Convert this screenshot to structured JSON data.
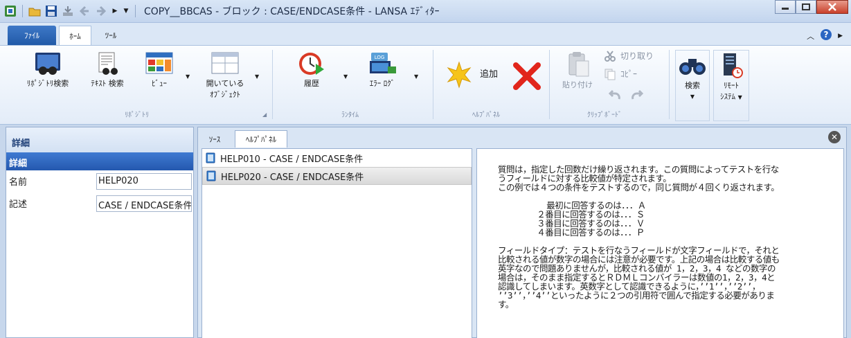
{
  "window": {
    "title": "COPY__BBCAS - ブロック : CASE/ENDCASE条件 - LANSA ｴﾃﾞｨﾀｰ"
  },
  "ribbon_tabs": {
    "file": "ﾌｧｲﾙ",
    "home": "ﾎｰﾑ",
    "tools": "ﾂｰﾙ"
  },
  "ribbon": {
    "repo_search": "ﾘﾎﾟｼﾞﾄﾘ検索",
    "text_search": "ﾃｷｽﾄ 検索",
    "view": "ﾋﾞｭｰ",
    "open_objects_1": "開いている",
    "open_objects_2": "ｵﾌﾞｼﾞｪｸﾄ",
    "group_repository": "ﾘﾎﾟｼﾞﾄﾘ",
    "history": "履歴",
    "error_log": "ｴﾗｰ ﾛｸﾞ",
    "group_runtime": "ﾗﾝﾀｲﾑ",
    "add": "追加",
    "group_helppanel": "ﾍﾙﾌﾟﾊﾟﾈﾙ",
    "paste": "貼り付け",
    "cut": "切り取り",
    "copy": "ｺﾋﾟｰ",
    "group_clipboard": "ｸﾘｯﾌﾟﾎﾞｰﾄﾞ",
    "search": "検索",
    "remote_1": "ﾘﾓｰﾄ",
    "remote_2": "ｼｽﾃﾑ"
  },
  "left_panel": {
    "header": "詳細",
    "section": "詳細",
    "name_label": "名前",
    "name_value": "HELP020",
    "desc_label": "記述",
    "desc_value": "CASE / ENDCASE条件"
  },
  "content_tabs": {
    "source": "ｿｰｽ",
    "help": "ﾍﾙﾌﾟﾊﾟﾈﾙ"
  },
  "help_items": [
    {
      "label": "HELP010 - CASE / ENDCASE条件"
    },
    {
      "label": "HELP020 - CASE / ENDCASE条件"
    }
  ],
  "help_text": "質問は，指定した回数だけ繰り返されます。この質問によってテストを行な\nうフィールドに対する比較値が特定されます。\nこの例では４つの条件をテストするので，同じ質問が４回くり返されます。\n\n          最初に回答するのは．．．Ａ\n        ２番目に回答するのは．．．Ｓ\n        ３番目に回答するのは．．．Ｖ\n        ４番目に回答するのは．．．Ｐ\n\nフィールドタイプ：テストを行なうフィールドが文字フィールドで，それと\n比較される値が数字の場合には注意が必要です。上記の場合は比較する値も\n英字なので問題ありませんが，比較される値が 1，2，3，4 などの数字の\n場合は，そのまま指定するとＲＤＭＬコンバイラーは数値の1，2，3，4と\n認識してしまいます。英数字として認識できるように，’’1’’，’’2’’，\n’’3’’，’’4’’といったように２つの引用符で囲んで指定する必要がありま\nす。"
}
